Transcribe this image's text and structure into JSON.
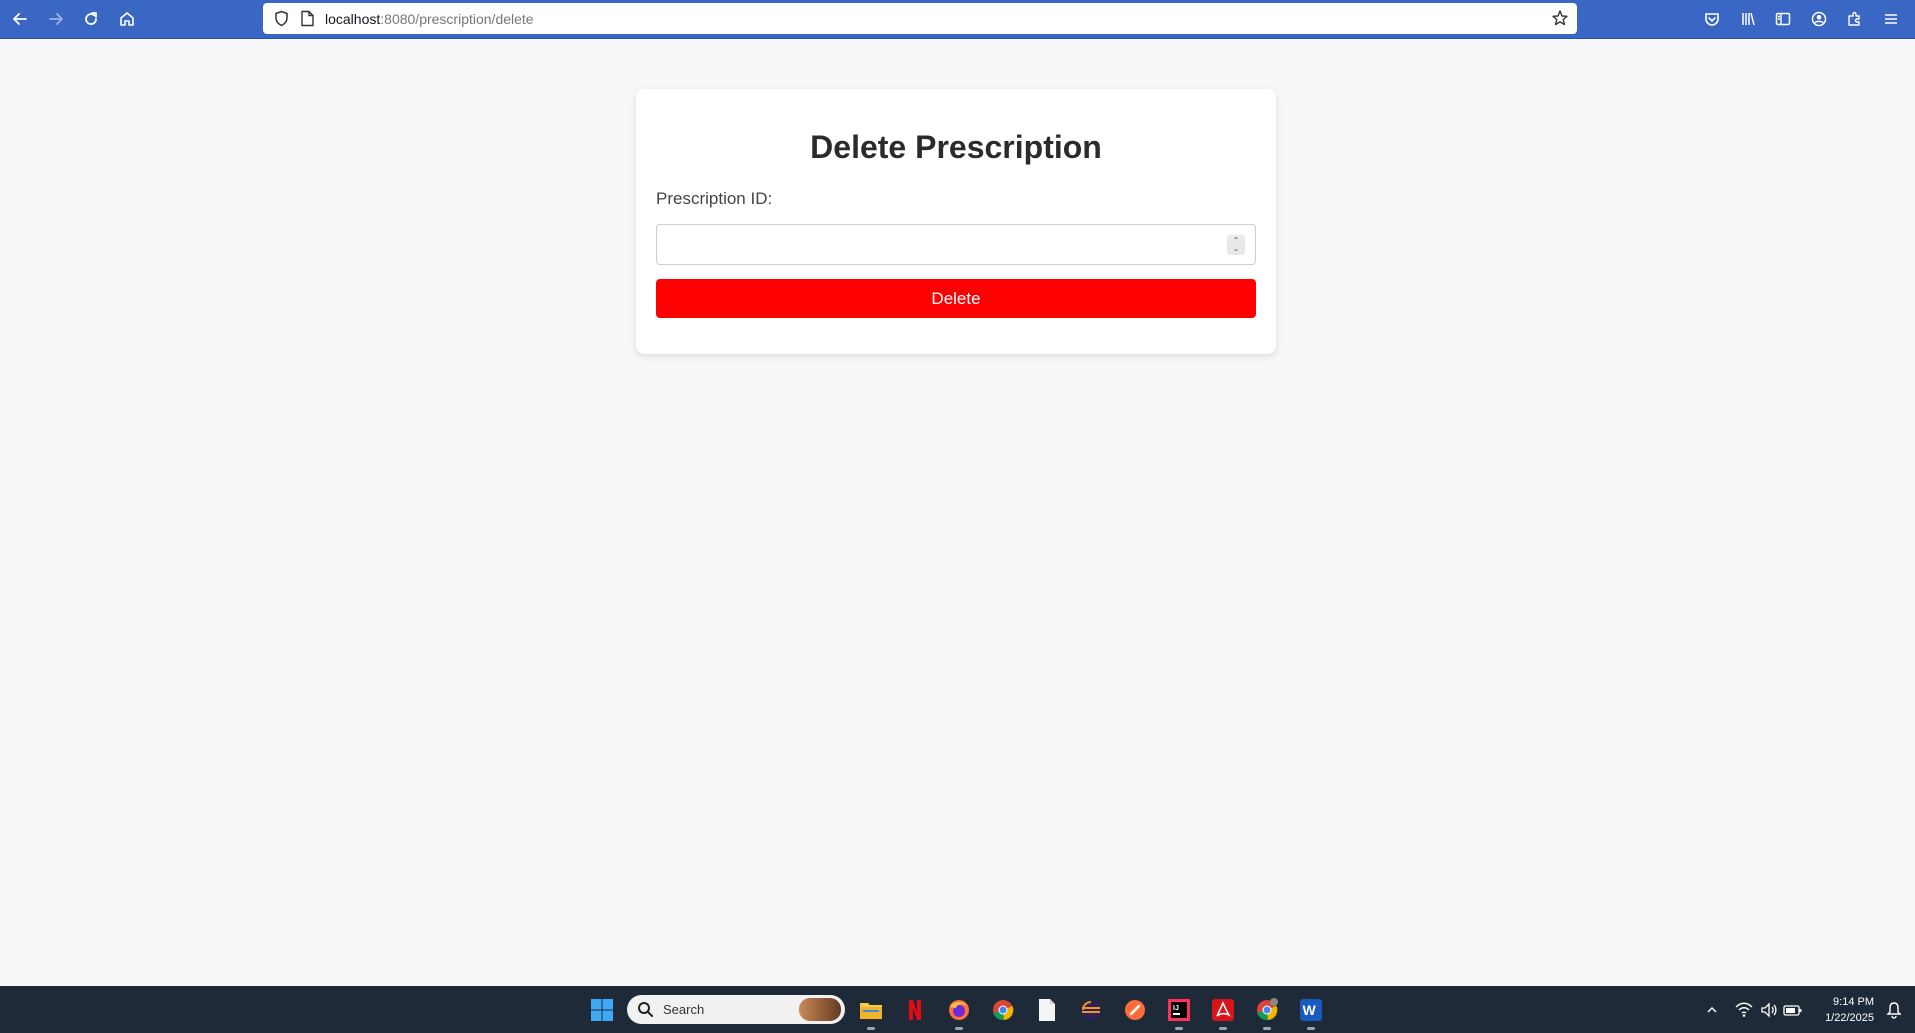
{
  "browser": {
    "url_host": "localhost",
    "url_rest": ":8080/prescription/delete",
    "icons": [
      "back-icon",
      "forward-icon",
      "reload-icon",
      "home-icon",
      "shield-icon",
      "page-icon",
      "bookmark-star-icon",
      "pocket-icon",
      "library-icon",
      "sidebar-icon",
      "account-icon",
      "extensions-icon",
      "menu-icon"
    ]
  },
  "form": {
    "title": "Delete Prescription",
    "id_label": "Prescription ID:",
    "id_value": "",
    "submit_label": "Delete"
  },
  "colors": {
    "toolbar": "#3a66c4",
    "delete_button": "#ff0000",
    "page_background": "#f8f8f8",
    "taskbar": "#1f2a38"
  },
  "taskbar": {
    "search_placeholder": "Search",
    "apps": [
      "windows-start-icon",
      "file-explorer-icon",
      "netflix-icon",
      "firefox-icon",
      "chrome-icon",
      "file-icon",
      "eclipse-icon",
      "postman-icon",
      "intellij-icon",
      "acrobat-icon",
      "chrome-profile-icon",
      "word-icon"
    ],
    "tray_icons": [
      "chevron-up-icon",
      "wifi-icon",
      "volume-icon",
      "battery-icon",
      "notification-icon"
    ],
    "time": "9:14 PM",
    "date": "1/22/2025"
  }
}
